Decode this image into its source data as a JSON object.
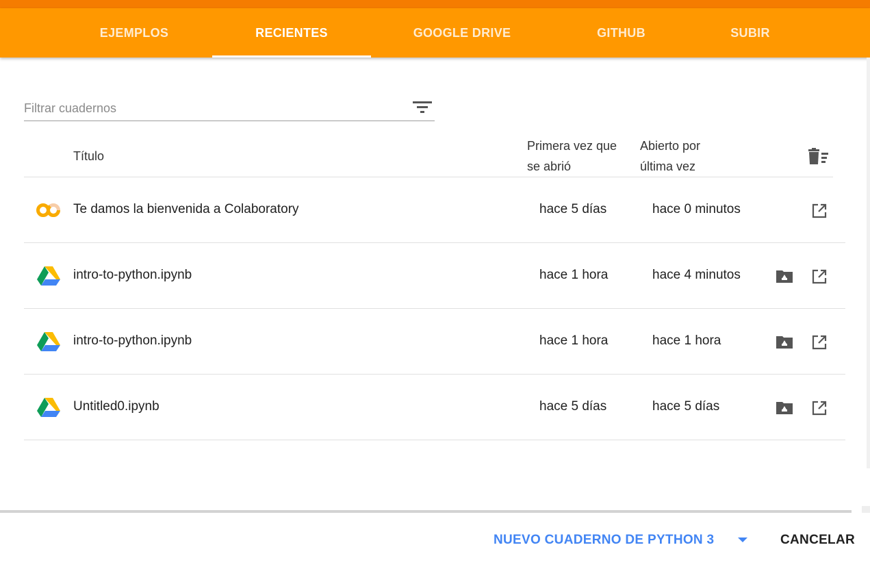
{
  "tabs": [
    {
      "label": "EJEMPLOS",
      "active": false
    },
    {
      "label": "RECIENTES",
      "active": true
    },
    {
      "label": "GOOGLE DRIVE",
      "active": false
    },
    {
      "label": "GITHUB",
      "active": false
    },
    {
      "label": "SUBIR",
      "active": false
    }
  ],
  "filter": {
    "placeholder": "Filtrar cuadernos",
    "value": "",
    "icon": "filter-list-icon"
  },
  "table": {
    "headers": {
      "title": "Título",
      "first_opened_line1": "Primera vez que",
      "first_opened_line2": "se abrió",
      "last_opened_line1": "Abierto por",
      "last_opened_line2": "última vez"
    },
    "rows": [
      {
        "icon": "colab-logo-icon",
        "title": "Te damos la bienvenida a Colaboratory",
        "first_opened": "hace 5 días",
        "last_opened": "hace 0 minutos",
        "has_drive_folder": false
      },
      {
        "icon": "google-drive-icon",
        "title": "intro-to-python.ipynb",
        "first_opened": "hace 1 hora",
        "last_opened": "hace 4 minutos",
        "has_drive_folder": true
      },
      {
        "icon": "google-drive-icon",
        "title": "intro-to-python.ipynb",
        "first_opened": "hace 1 hora",
        "last_opened": "hace 1 hora",
        "has_drive_folder": true
      },
      {
        "icon": "google-drive-icon",
        "title": "Untitled0.ipynb",
        "first_opened": "hace 5 días",
        "last_opened": "hace 5 días",
        "has_drive_folder": true
      }
    ]
  },
  "footer": {
    "new_notebook_label": "NUEVO CUADERNO DE PYTHON 3",
    "cancel_label": "CANCELAR"
  },
  "colors": {
    "header_orange": "#ff9800",
    "header_dark_orange": "#f57c00",
    "accent_blue": "#4285f4",
    "colab_yellow": "#f9ab00"
  }
}
